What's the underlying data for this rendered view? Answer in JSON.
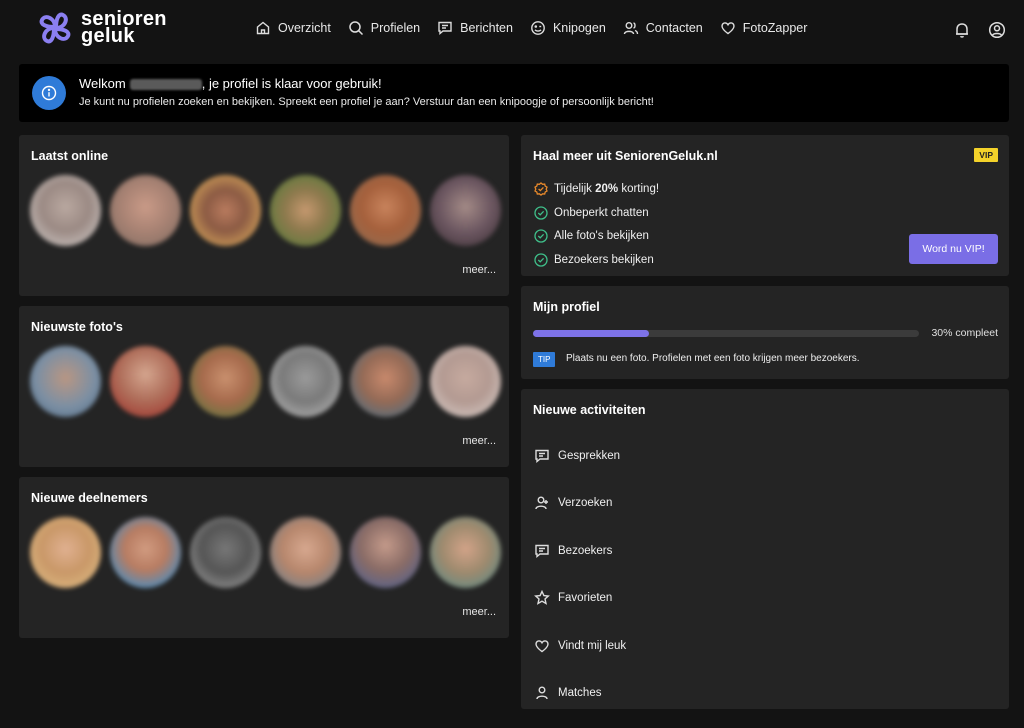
{
  "brand": {
    "line1": "senioren",
    "line2": "geluk",
    "color": "#8b7ff0"
  },
  "nav": [
    {
      "label": "Overzicht",
      "icon": "home-icon"
    },
    {
      "label": "Profielen",
      "icon": "search-icon"
    },
    {
      "label": "Berichten",
      "icon": "message-icon"
    },
    {
      "label": "Knipogen",
      "icon": "wink-icon"
    },
    {
      "label": "Contacten",
      "icon": "contacts-icon"
    },
    {
      "label": "FotoZapper",
      "icon": "heart-icon"
    }
  ],
  "header_icons": [
    "bell-icon",
    "account-icon"
  ],
  "welcome": {
    "greeting": "Welkom",
    "suffix": ", je profiel is klaar voor gebruik!",
    "message": "Je kunt nu profielen zoeken en bekijken. Spreekt een profiel je aan? Verstuur dan een knipoogje of persoonlijk bericht!"
  },
  "sections": {
    "online": {
      "title": "Laatst online",
      "more": "meer..."
    },
    "photos": {
      "title": "Nieuwste foto's",
      "more": "meer..."
    },
    "members": {
      "title": "Nieuwe deelnemers",
      "more": "meer..."
    }
  },
  "vip": {
    "title": "Haal meer uit SeniorenGeluk.nl",
    "badge": "VIP",
    "items": [
      {
        "pre": "Tijdelijk ",
        "bold": "20%",
        "post": " korting!",
        "icon_color": "#e8892b"
      },
      {
        "pre": "Onbeperkt chatten",
        "bold": "",
        "post": "",
        "icon_color": "#3fbf8a"
      },
      {
        "pre": "Alle foto's bekijken",
        "bold": "",
        "post": "",
        "icon_color": "#3fbf8a"
      },
      {
        "pre": "Bezoekers bekijken",
        "bold": "",
        "post": "",
        "icon_color": "#3fbf8a"
      }
    ],
    "button": "Word nu VIP!"
  },
  "profile": {
    "title": "Mijn profiel",
    "progress": 30,
    "progress_label": "30% compleet",
    "tip_badge": "TIP",
    "tip_text": "Plaats nu een foto. Profielen met een foto krijgen meer bezoekers."
  },
  "activities": {
    "title": "Nieuwe activiteiten",
    "items": [
      {
        "label": "Gesprekken",
        "icon": "chat-icon"
      },
      {
        "label": "Verzoeken",
        "icon": "person-icon"
      },
      {
        "label": "Bezoekers",
        "icon": "chat-icon"
      },
      {
        "label": "Favorieten",
        "icon": "star-icon"
      },
      {
        "label": "Vindt mij leuk",
        "icon": "heart-icon"
      },
      {
        "label": "Matches",
        "icon": "person-icon"
      }
    ]
  }
}
